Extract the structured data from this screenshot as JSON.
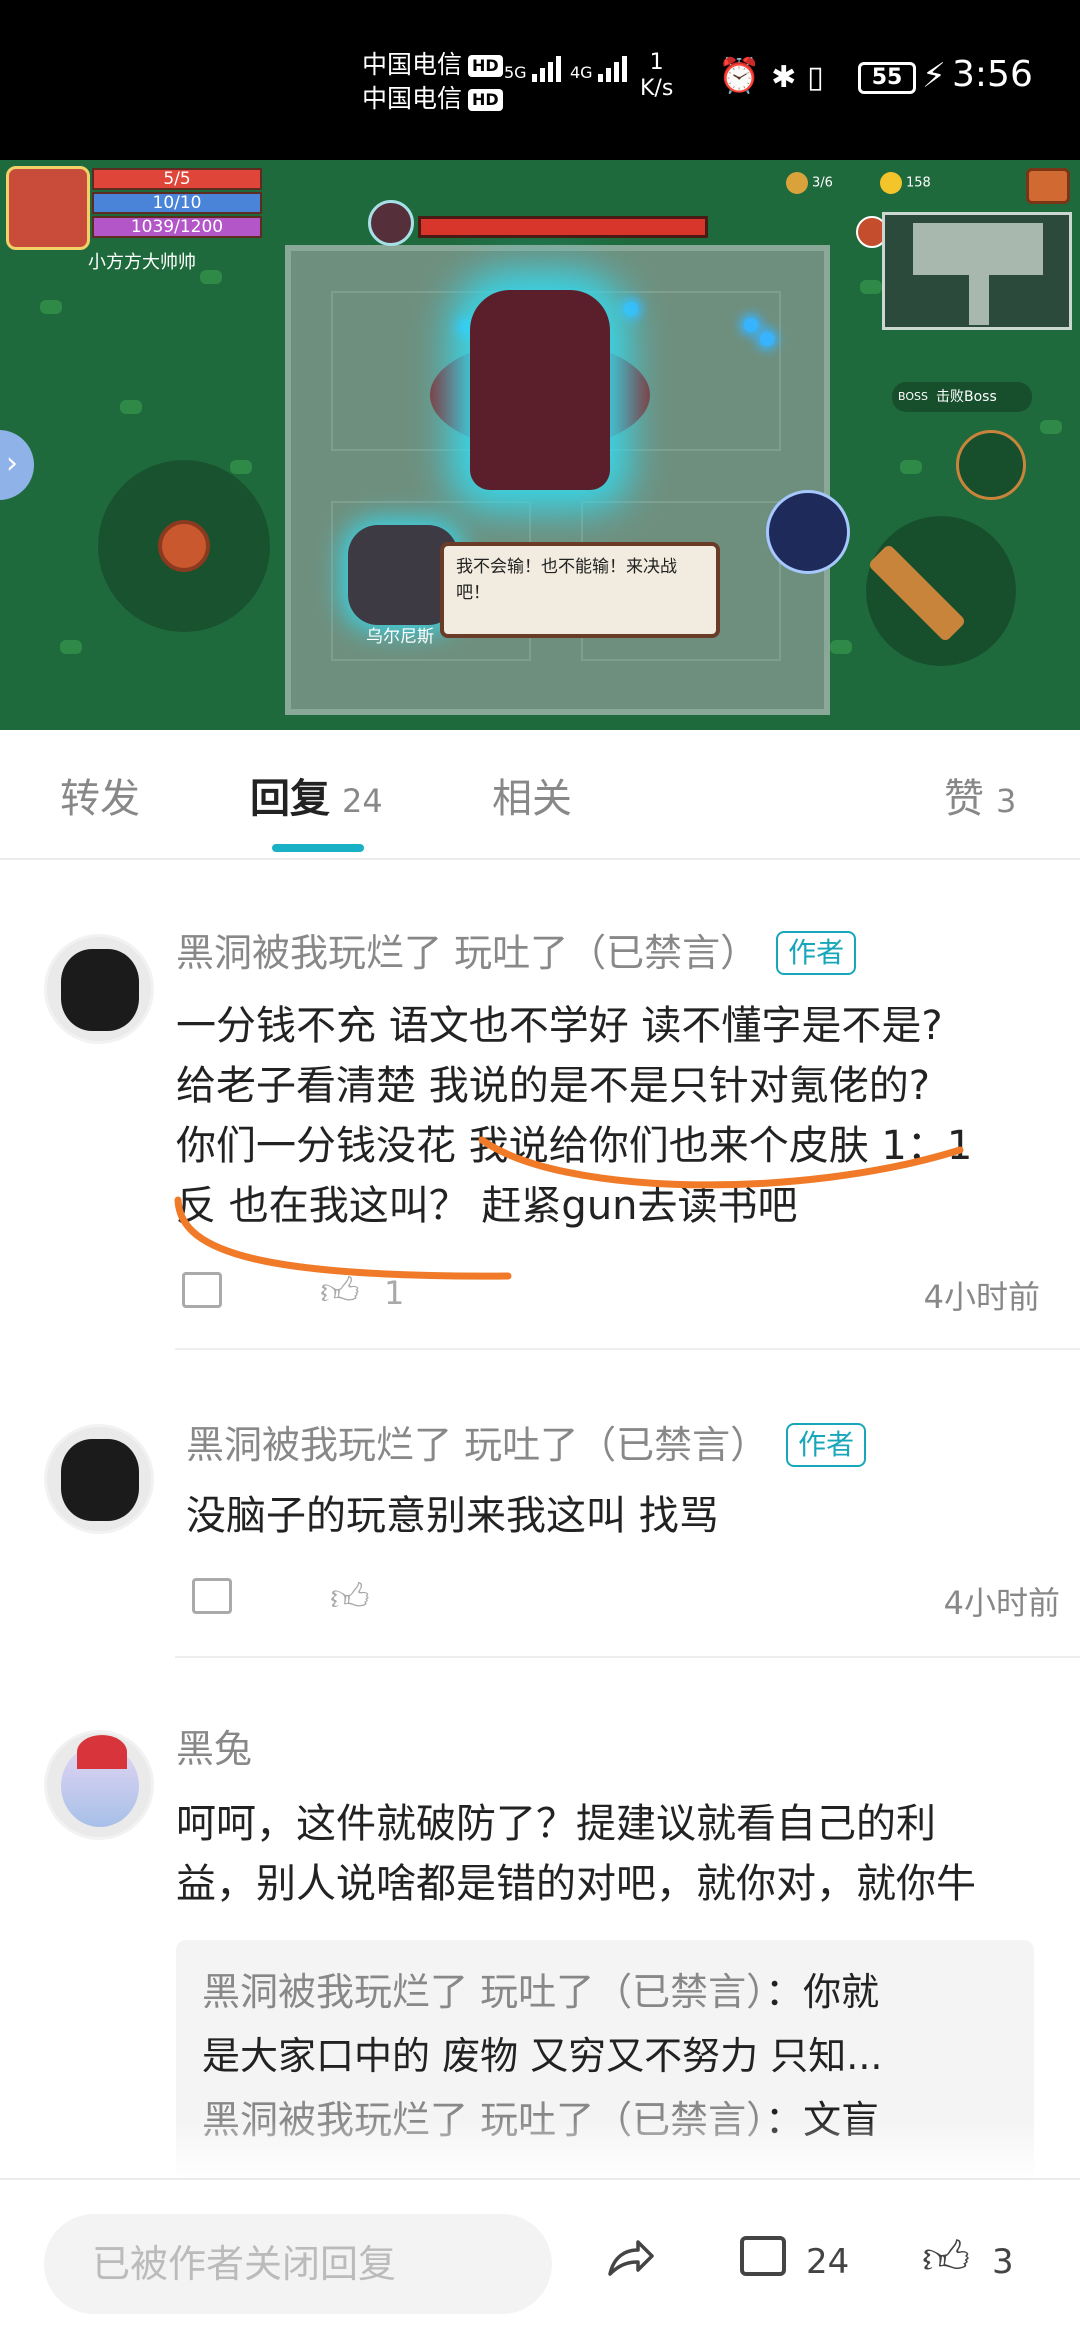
{
  "status_bar": {
    "carrier_1": "中国电信",
    "carrier_2": "中国电信",
    "hd": "HD",
    "net_1": "5G",
    "net_2": "4G",
    "speed_value": "1",
    "speed_unit": "K/s",
    "battery": "55",
    "time": "3:56"
  },
  "game": {
    "hp": "5/5",
    "armor": "10/10",
    "energy": "1039/1200",
    "player_name": "小方方大帅帅",
    "counter": "3/6",
    "coins": "158",
    "boss_label": "击败Boss",
    "boss_badge": "BOSS",
    "npc_name": "乌尔尼斯",
    "dialog": "我不会输！也不能输！来决战吧！"
  },
  "tabs": [
    {
      "label": "转发",
      "count": ""
    },
    {
      "label": "回复",
      "count": "24"
    },
    {
      "label": "相关",
      "count": ""
    },
    {
      "label": "赞",
      "count": "3"
    }
  ],
  "comments": [
    {
      "name": "黑洞被我玩烂了 玩吐了（已禁言）",
      "tag": "作者",
      "lines": [
        "一分钱不充 语文也不学好 读不懂字是不是?",
        "给老子看清楚 我说的是不是只针对氪佬的?",
        "你们一分钱没花 我说给你们也来个皮肤 1：1",
        "反 也在我这叫？ 赶紧gun去读书吧"
      ],
      "likes": "1",
      "time": "4小时前"
    },
    {
      "name": "黑洞被我玩烂了 玩吐了（已禁言）",
      "tag": "作者",
      "lines": [
        "没脑子的玩意别来我这叫 找骂"
      ],
      "likes": "",
      "time": "4小时前"
    },
    {
      "name": "黑兔",
      "tag": "",
      "lines": [
        "呵呵，这件就破防了？提建议就看自己的利",
        "益，别人说啥都是错的对吧，就你对，就你牛"
      ],
      "quotes": [
        {
          "name": "黑洞被我玩烂了 玩吐了（已禁言）",
          "text": "：你就"
        },
        {
          "name": "",
          "text": "是大家口中的 废物 又穷又不努力 只知..."
        },
        {
          "name": "黑洞被我玩烂了 玩吐了（已禁言）",
          "text": "：文盲"
        }
      ]
    }
  ],
  "bottom_bar": {
    "input_placeholder": "已被作者关闭回复",
    "comment_count": "24",
    "like_count": "3"
  },
  "colors": {
    "accent": "#18b1c6",
    "annotation": "#f07a28",
    "game_green": "#1f6a3d"
  }
}
